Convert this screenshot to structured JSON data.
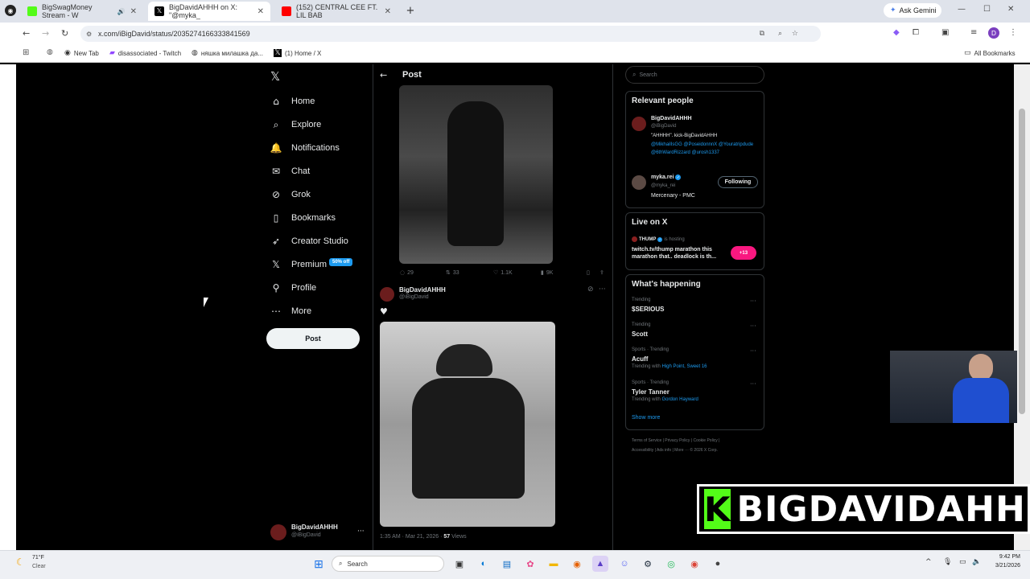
{
  "browser": {
    "tabs": [
      {
        "label": "BigSwagMoney Stream - W",
        "color": "#53fc18"
      },
      {
        "label": "BigDavidAHHH on X: \"@myka_",
        "color": "#000000"
      },
      {
        "label": "(152) CENTRAL CEE FT. LIL BAB",
        "color": "#ff0000"
      }
    ],
    "gemini_label": "Ask Gemini",
    "url": "x.com/iBigDavid/status/2035274166333841569",
    "bookmarks": [
      "New Tab",
      "disassociated - Twitch",
      "няшка милашка да...",
      "(1) Home / X"
    ],
    "all_bookmarks": "All Bookmarks",
    "profile_initial": "D"
  },
  "nav": {
    "items": [
      {
        "label": "Home",
        "icon": "home-icon",
        "glyph": "⌂"
      },
      {
        "label": "Explore",
        "icon": "search-icon",
        "glyph": "⌕"
      },
      {
        "label": "Notifications",
        "icon": "bell-icon",
        "glyph": "🔔"
      },
      {
        "label": "Chat",
        "icon": "mail-icon",
        "glyph": "✉"
      },
      {
        "label": "Grok",
        "icon": "grok-icon",
        "glyph": "⊘"
      },
      {
        "label": "Bookmarks",
        "icon": "bookmark-icon",
        "glyph": "▯"
      },
      {
        "label": "Creator Studio",
        "icon": "rocket-icon",
        "glyph": "➶"
      },
      {
        "label": "Premium",
        "icon": "x-logo-icon",
        "glyph": "𝕏"
      },
      {
        "label": "Profile",
        "icon": "person-icon",
        "glyph": "⚲"
      },
      {
        "label": "More",
        "icon": "more-circle-icon",
        "glyph": "⋯"
      }
    ],
    "premium_badge": "50% off",
    "post_button": "Post",
    "account_name": "BigDavidAHHH",
    "account_handle": "@iBigDavid"
  },
  "post": {
    "header": "Post",
    "stats": {
      "replies": "29",
      "reposts": "33",
      "likes": "1.1K",
      "views": "9K"
    },
    "author_name": "BigDavidAHHH",
    "author_handle": "@iBigDavid",
    "timestamp": "1:35 AM · Mar 21, 2026 · ",
    "views_count": "57",
    "views_label": " Views"
  },
  "sidebar": {
    "search_placeholder": "Search",
    "relevant_title": "Relevant people",
    "person1_name": "BigDavidAHHH",
    "person1_handle": "@iBigDavid",
    "person1_bio": "\"AHHHH\". kick-BigDavidAHHH",
    "person1_mentions": "@MikhailIsGG @PoseidonnnX @Youratripdude @6thWardRizzard @urosh1337",
    "person2_name": "myka.rei",
    "person2_handle": "@myka_rei",
    "person2_bio": "Mercenary - PMC",
    "following_label": "Following",
    "live_title": "Live on X",
    "live_host": "THUMP",
    "live_hosting": " is hosting",
    "live_text": "twitch.tv/thump marathon this marathon that.. deadlock is th...",
    "live_count": "+13",
    "happening_title": "What's happening",
    "trends": [
      {
        "context": "Trending",
        "name": "$SERIOUS",
        "with": ""
      },
      {
        "context": "Trending",
        "name": "Scott",
        "with": ""
      },
      {
        "context": "Sports · Trending",
        "name": "Acuff",
        "with": "Trending with ",
        "with_link": "High Point, Sweet 16"
      },
      {
        "context": "Sports · Trending",
        "name": "Tyler Tanner",
        "with": "Trending with ",
        "with_link": "Gordon Hayward"
      }
    ],
    "show_more": "Show more",
    "footer1": "Terms of Service  |  Privacy Policy  |  Cookie Policy  |",
    "footer2": "Accessibility  |  Ads info  |  More ···  © 2026 X Corp."
  },
  "taskbar": {
    "weather_temp": "71°F",
    "weather_desc": "Clear",
    "search_label": "Search",
    "time": "9:42 PM",
    "date": "3/21/2026"
  },
  "overlay": {
    "kick_letter": "K",
    "streamer_name": "BIGDAVIDAHHH"
  }
}
